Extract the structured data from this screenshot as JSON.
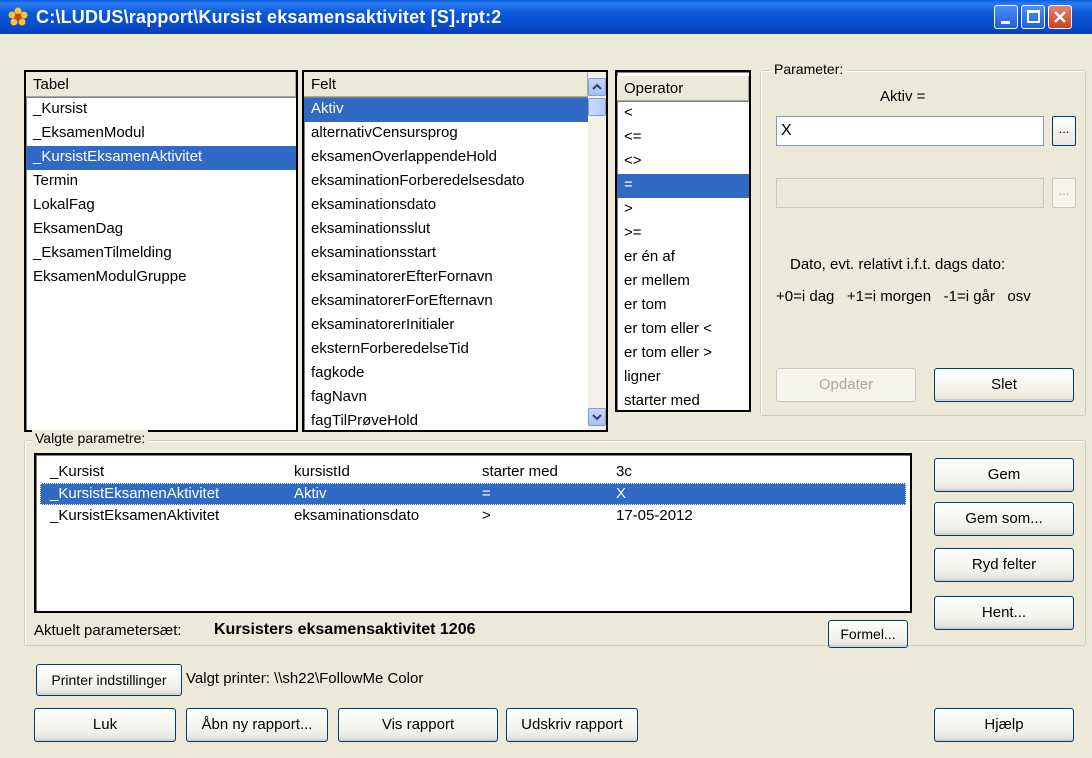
{
  "window": {
    "title": "C:\\LUDUS\\rapport\\Kursist eksamensaktivitet [S].rpt:2"
  },
  "tabel": {
    "header": "Tabel",
    "items": [
      "_Kursist",
      "_EksamenModul",
      "_KursistEksamenAktivitet",
      "Termin",
      "LokalFag",
      "EksamenDag",
      "_EksamenTilmelding",
      "EksamenModulGruppe"
    ],
    "selected": "_KursistEksamenAktivitet"
  },
  "felt": {
    "header": "Felt",
    "items": [
      "Aktiv",
      "alternativCensursprog",
      "eksamenOverlappendeHold",
      "eksaminationForberedelsesdato",
      "eksaminationsdato",
      "eksaminationsslut",
      "eksaminationsstart",
      "eksaminatorerEfterFornavn",
      "eksaminatorerForEfternavn",
      "eksaminatorerInitialer",
      "eksternForberedelseTid",
      "fagkode",
      "fagNavn",
      "fagTilPrøveHold"
    ],
    "selected": "Aktiv"
  },
  "operator": {
    "header": "Operator",
    "items": [
      "<",
      "<=",
      "<>",
      "=",
      ">",
      ">=",
      "er én af",
      "er mellem",
      "er tom",
      "er tom eller <",
      "er tom eller >",
      "ligner",
      "starter med"
    ],
    "selected": "="
  },
  "parameter": {
    "group_label": "Parameter:",
    "field_caption": "Aktiv =",
    "value1": "X",
    "value2": "",
    "dots_label": "...",
    "hint_line1": "Dato, evt. relativt i.f.t. dags dato:",
    "hint_line2": "+0=i dag   +1=i morgen   -1=i går   osv",
    "update_btn": "Opdater",
    "delete_btn": "Slet"
  },
  "selected_params": {
    "group_label": "Valgte parametre:",
    "rows": [
      {
        "table": "_Kursist",
        "field": "kursistId",
        "op": "starter med",
        "value": "3c"
      },
      {
        "table": "_KursistEksamenAktivitet",
        "field": "Aktiv",
        "op": "=",
        "value": "X"
      },
      {
        "table": "_KursistEksamenAktivitet",
        "field": "eksaminationsdato",
        "op": ">",
        "value": "17-05-2012"
      }
    ],
    "current_label": "Aktuelt parametersæt:",
    "current_value": "Kursisters eksamensaktivitet 1206",
    "formula_btn": "Formel..."
  },
  "side_buttons": {
    "save": "Gem",
    "save_as": "Gem som...",
    "clear": "Ryd felter",
    "fetch": "Hent..."
  },
  "printer": {
    "settings_btn": "Printer indstillinger",
    "selected_label": "Valgt printer: \\\\sh22\\FollowMe Color"
  },
  "bottom_buttons": {
    "close": "Luk",
    "open_new": "Åbn ny rapport...",
    "show": "Vis rapport",
    "print": "Udskriv rapport",
    "help": "Hjælp"
  },
  "colors": {
    "selection": "#316ac5",
    "titlebar": "#0b57d8",
    "background": "#ece9d8"
  }
}
